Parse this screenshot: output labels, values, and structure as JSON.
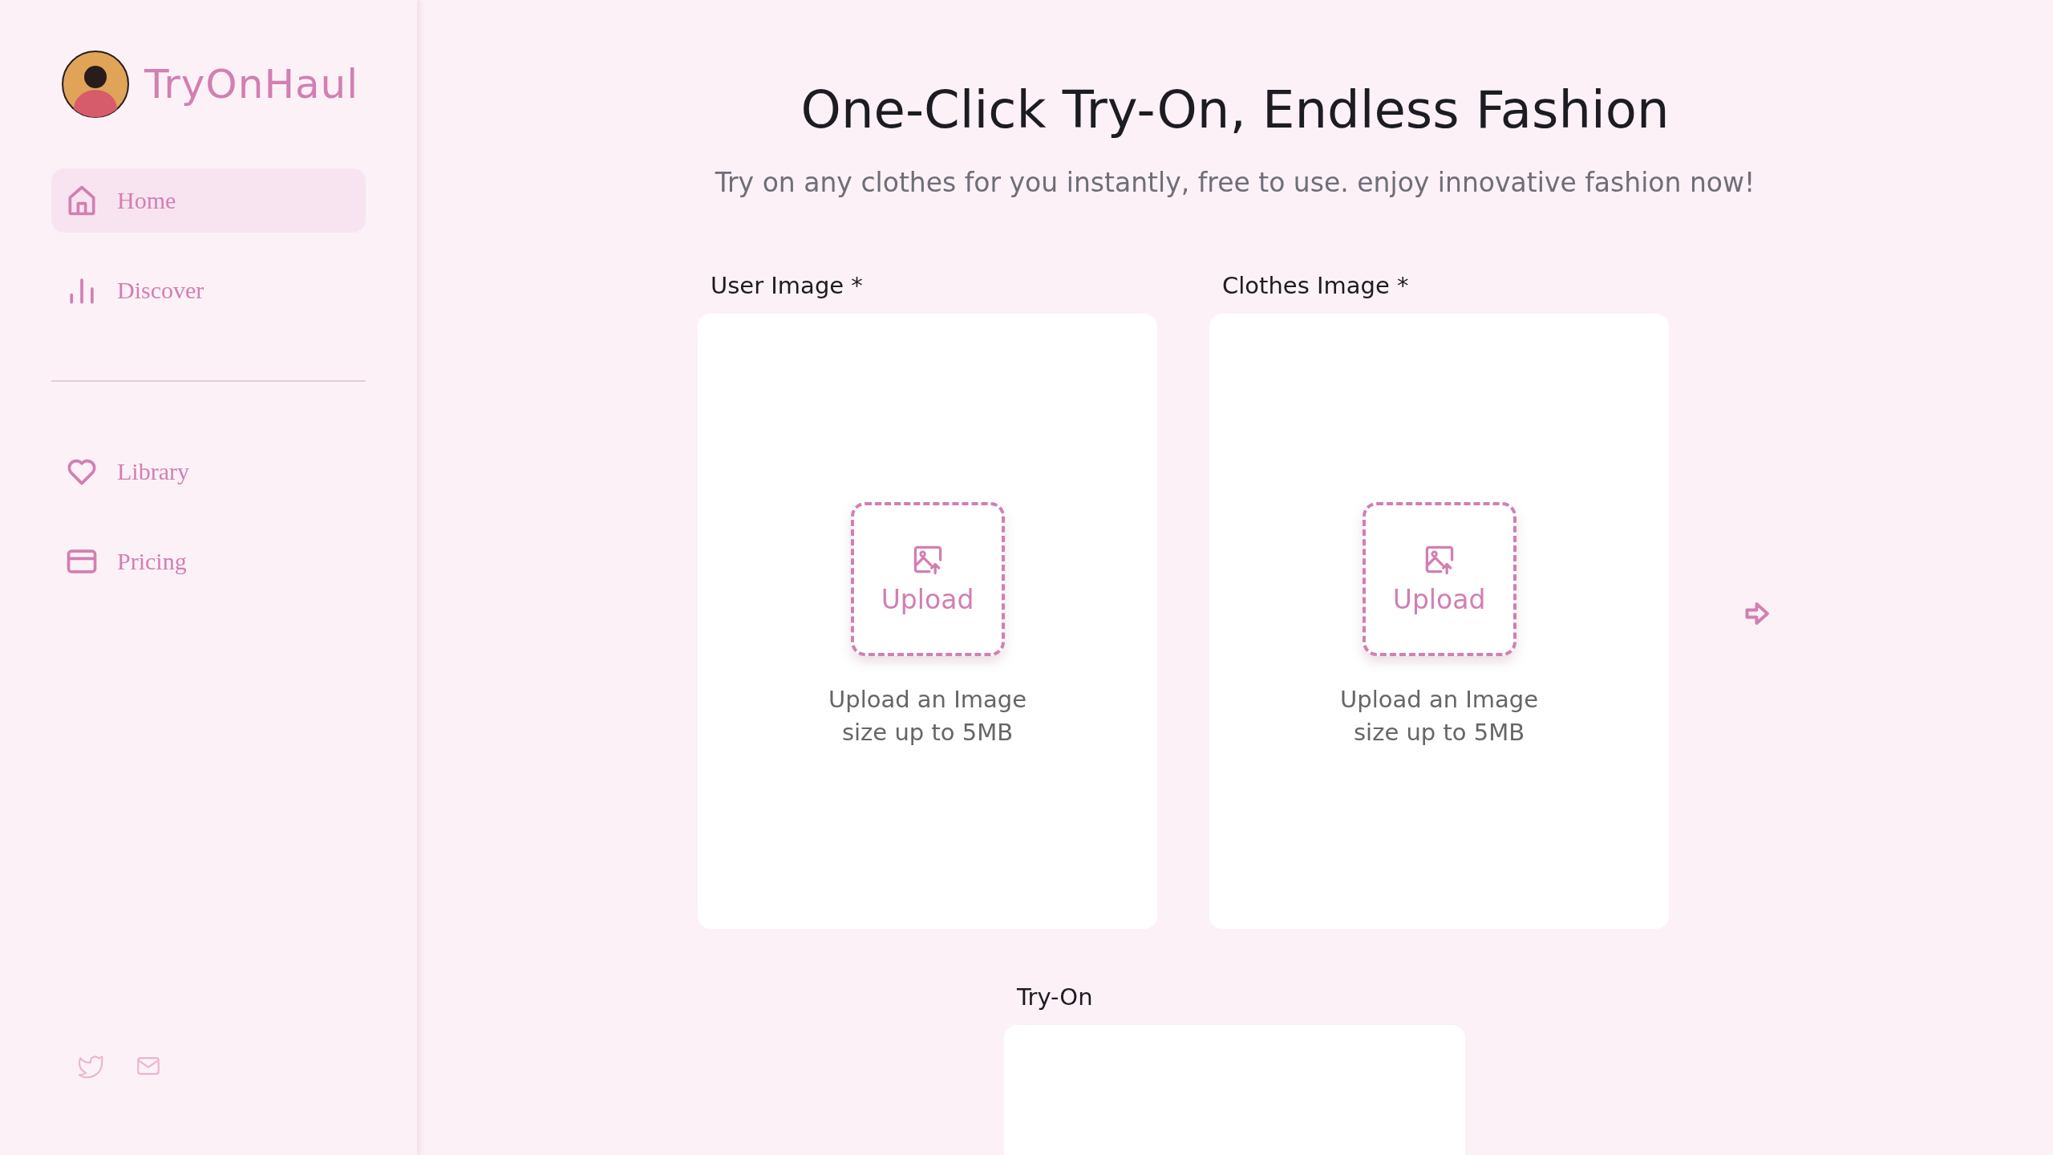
{
  "brand": {
    "name": "TryOnHaul"
  },
  "nav": [
    {
      "label": "Home",
      "kind": "home",
      "selected": true
    },
    {
      "label": "Discover",
      "kind": "chart",
      "selected": false
    }
  ],
  "nav_secondary": [
    {
      "label": "Library",
      "kind": "heart",
      "selected": false
    },
    {
      "label": "Pricing",
      "kind": "card",
      "selected": false
    }
  ],
  "footer_links": [
    {
      "kind": "bird"
    },
    {
      "kind": "mail"
    }
  ],
  "hero": {
    "title": "One-Click Try-On, Endless Fashion",
    "subtitle": "Try on any clothes for you instantly, free to use. enjoy innovative fashion now!"
  },
  "uploads": [
    {
      "label": "User Image *",
      "button": "Upload",
      "hint": "Upload an Image",
      "limit": "size up to 5MB"
    },
    {
      "label": "Clothes Image *",
      "button": "Upload",
      "hint": "Upload an Image",
      "limit": "size up to 5MB"
    }
  ],
  "result": {
    "label": "Try-On"
  }
}
